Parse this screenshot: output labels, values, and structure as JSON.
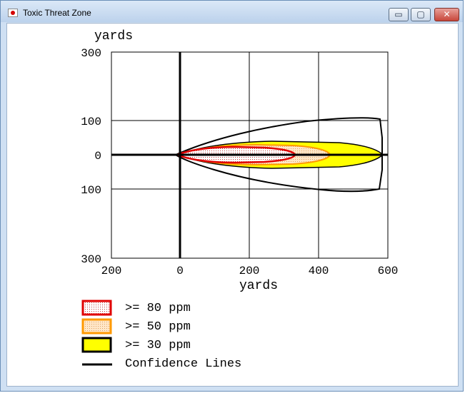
{
  "window": {
    "title": "Toxic Threat Zone",
    "buttons": {
      "minimize": "▭",
      "maximize": "▢",
      "close": "✕"
    }
  },
  "plot": {
    "y_unit": "yards",
    "x_unit": "yards",
    "y_tick_labels": [
      "300",
      "100",
      "0",
      "100",
      "300"
    ],
    "x_tick_labels": [
      "200",
      "0",
      "200",
      "400",
      "600"
    ]
  },
  "legend": [
    {
      "label": ">= 80 ppm",
      "border": "#e00000",
      "fill": "dotted-white"
    },
    {
      "label": ">= 50 ppm",
      "border": "#ff9900",
      "fill": "dotted-peach"
    },
    {
      "label": ">= 30 ppm",
      "border": "#000000",
      "fill": "#ffff00"
    },
    {
      "label": "Confidence Lines",
      "line": "#000000"
    }
  ],
  "colors": {
    "zone_80": "#e00000",
    "zone_50": "#ff9900",
    "zone_30_fill": "#ffff00",
    "axes": "#000000"
  }
}
